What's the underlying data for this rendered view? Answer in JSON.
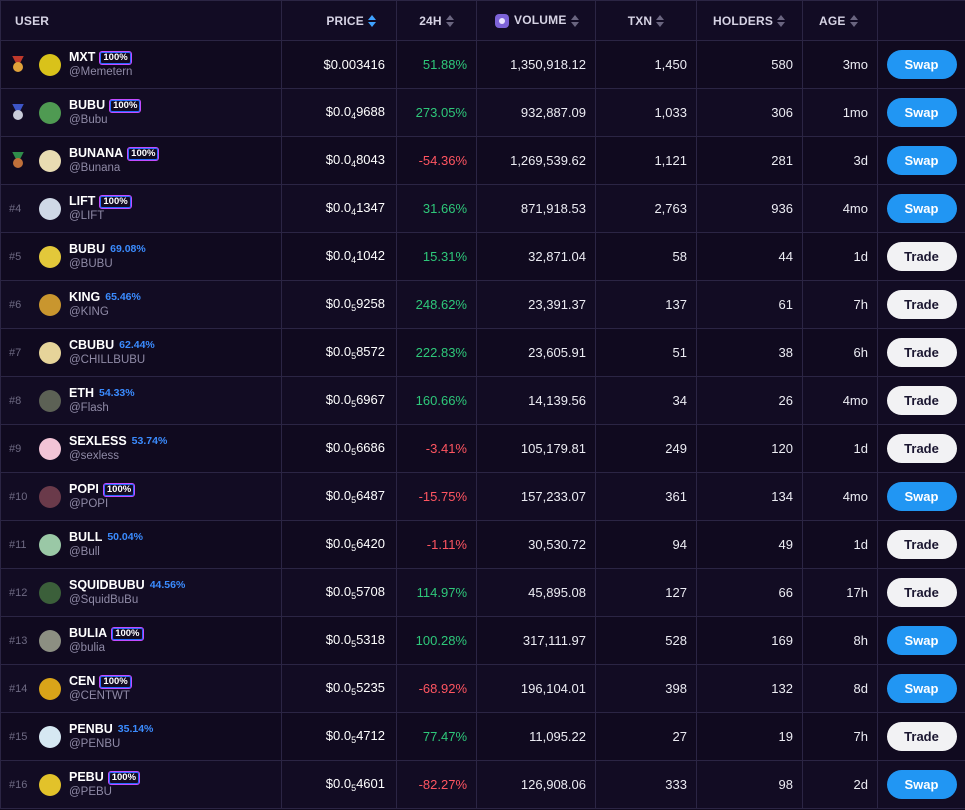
{
  "header": {
    "user": "USER",
    "price": "PRICE",
    "h24": "24H",
    "volume": "VOLUME",
    "txn": "TXN",
    "holders": "HOLDERS",
    "age": "AGE"
  },
  "colors": {
    "accent_blue": "#2196f3",
    "positive": "#2ec87a",
    "negative": "#ff5561",
    "percent_text": "#3b8cff",
    "background": "#0f0a1e"
  },
  "rows": [
    {
      "rank": "",
      "medal": "gold",
      "name": "MXT",
      "pct": "100%",
      "handle": "@Memetern",
      "price_pre": "$0.003416",
      "price_sub": "",
      "price_post": "",
      "change": "51.88%",
      "dir": "pos",
      "volume": "1,350,918.12",
      "txn": "1,450",
      "holders": "580",
      "age": "3mo",
      "action": "Swap",
      "avatar": "#d9c21a"
    },
    {
      "rank": "",
      "medal": "silver",
      "name": "BUBU",
      "pct": "100%",
      "handle": "@Bubu",
      "price_pre": "$0.0",
      "price_sub": "4",
      "price_post": "9688",
      "change": "273.05%",
      "dir": "pos",
      "volume": "932,887.09",
      "txn": "1,033",
      "holders": "306",
      "age": "1mo",
      "action": "Swap",
      "avatar": "#4f9a52"
    },
    {
      "rank": "",
      "medal": "bronze",
      "name": "BUNANA",
      "pct": "100%",
      "handle": "@Bunana",
      "price_pre": "$0.0",
      "price_sub": "4",
      "price_post": "8043",
      "change": "-54.36%",
      "dir": "neg",
      "volume": "1,269,539.62",
      "txn": "1,121",
      "holders": "281",
      "age": "3d",
      "action": "Swap",
      "avatar": "#e8dcb2"
    },
    {
      "rank": "#4",
      "medal": "",
      "name": "LIFT",
      "pct": "100%",
      "handle": "@LIFT",
      "price_pre": "$0.0",
      "price_sub": "4",
      "price_post": "1347",
      "change": "31.66%",
      "dir": "pos",
      "volume": "871,918.53",
      "txn": "2,763",
      "holders": "936",
      "age": "4mo",
      "action": "Swap",
      "avatar": "#cfd8e6"
    },
    {
      "rank": "#5",
      "medal": "",
      "name": "BUBU",
      "pct": "69.08%",
      "handle": "@BUBU",
      "price_pre": "$0.0",
      "price_sub": "4",
      "price_post": "1042",
      "change": "15.31%",
      "dir": "pos",
      "volume": "32,871.04",
      "txn": "58",
      "holders": "44",
      "age": "1d",
      "action": "Trade",
      "avatar": "#e3c83a"
    },
    {
      "rank": "#6",
      "medal": "",
      "name": "KING",
      "pct": "65.46%",
      "handle": "@KING",
      "price_pre": "$0.0",
      "price_sub": "5",
      "price_post": "9258",
      "change": "248.62%",
      "dir": "pos",
      "volume": "23,391.37",
      "txn": "137",
      "holders": "61",
      "age": "7h",
      "action": "Trade",
      "avatar": "#c9962e"
    },
    {
      "rank": "#7",
      "medal": "",
      "name": "CBUBU",
      "pct": "62.44%",
      "handle": "@CHILLBUBU",
      "price_pre": "$0.0",
      "price_sub": "5",
      "price_post": "8572",
      "change": "222.83%",
      "dir": "pos",
      "volume": "23,605.91",
      "txn": "51",
      "holders": "38",
      "age": "6h",
      "action": "Trade",
      "avatar": "#e6d49a"
    },
    {
      "rank": "#8",
      "medal": "",
      "name": "ETH",
      "pct": "54.33%",
      "handle": "@Flash",
      "price_pre": "$0.0",
      "price_sub": "5",
      "price_post": "6967",
      "change": "160.66%",
      "dir": "pos",
      "volume": "14,139.56",
      "txn": "34",
      "holders": "26",
      "age": "4mo",
      "action": "Trade",
      "avatar": "#5c6155"
    },
    {
      "rank": "#9",
      "medal": "",
      "name": "SEXLESS",
      "pct": "53.74%",
      "handle": "@sexless",
      "price_pre": "$0.0",
      "price_sub": "5",
      "price_post": "6686",
      "change": "-3.41%",
      "dir": "neg",
      "volume": "105,179.81",
      "txn": "249",
      "holders": "120",
      "age": "1d",
      "action": "Trade",
      "avatar": "#f2c4d6"
    },
    {
      "rank": "#10",
      "medal": "",
      "name": "POPI",
      "pct": "100%",
      "handle": "@POPI",
      "price_pre": "$0.0",
      "price_sub": "5",
      "price_post": "6487",
      "change": "-15.75%",
      "dir": "neg",
      "volume": "157,233.07",
      "txn": "361",
      "holders": "134",
      "age": "4mo",
      "action": "Swap",
      "avatar": "#6a3a4a"
    },
    {
      "rank": "#11",
      "medal": "",
      "name": "BULL",
      "pct": "50.04%",
      "handle": "@Bull",
      "price_pre": "$0.0",
      "price_sub": "5",
      "price_post": "6420",
      "change": "-1.11%",
      "dir": "neg",
      "volume": "30,530.72",
      "txn": "94",
      "holders": "49",
      "age": "1d",
      "action": "Trade",
      "avatar": "#9ac8a6"
    },
    {
      "rank": "#12",
      "medal": "",
      "name": "SQUIDBUBU",
      "pct": "44.56%",
      "handle": "@SquidBuBu",
      "price_pre": "$0.0",
      "price_sub": "5",
      "price_post": "5708",
      "change": "114.97%",
      "dir": "pos",
      "volume": "45,895.08",
      "txn": "127",
      "holders": "66",
      "age": "17h",
      "action": "Trade",
      "avatar": "#3b5f3a"
    },
    {
      "rank": "#13",
      "medal": "",
      "name": "BULIA",
      "pct": "100%",
      "handle": "@bulia",
      "price_pre": "$0.0",
      "price_sub": "5",
      "price_post": "5318",
      "change": "100.28%",
      "dir": "pos",
      "volume": "317,111.97",
      "txn": "528",
      "holders": "169",
      "age": "8h",
      "action": "Swap",
      "avatar": "#8c8f82"
    },
    {
      "rank": "#14",
      "medal": "",
      "name": "CEN",
      "pct": "100%",
      "handle": "@CENTWT",
      "price_pre": "$0.0",
      "price_sub": "5",
      "price_post": "5235",
      "change": "-68.92%",
      "dir": "neg",
      "volume": "196,104.01",
      "txn": "398",
      "holders": "132",
      "age": "8d",
      "action": "Swap",
      "avatar": "#d9a419"
    },
    {
      "rank": "#15",
      "medal": "",
      "name": "PENBU",
      "pct": "35.14%",
      "handle": "@PENBU",
      "price_pre": "$0.0",
      "price_sub": "5",
      "price_post": "4712",
      "change": "77.47%",
      "dir": "pos",
      "volume": "11,095.22",
      "txn": "27",
      "holders": "19",
      "age": "7h",
      "action": "Trade",
      "avatar": "#d6e8f2"
    },
    {
      "rank": "#16",
      "medal": "",
      "name": "PEBU",
      "pct": "100%",
      "handle": "@PEBU",
      "price_pre": "$0.0",
      "price_sub": "5",
      "price_post": "4601",
      "change": "-82.27%",
      "dir": "neg",
      "volume": "126,908.06",
      "txn": "333",
      "holders": "98",
      "age": "2d",
      "action": "Swap",
      "avatar": "#e2c22a"
    }
  ]
}
